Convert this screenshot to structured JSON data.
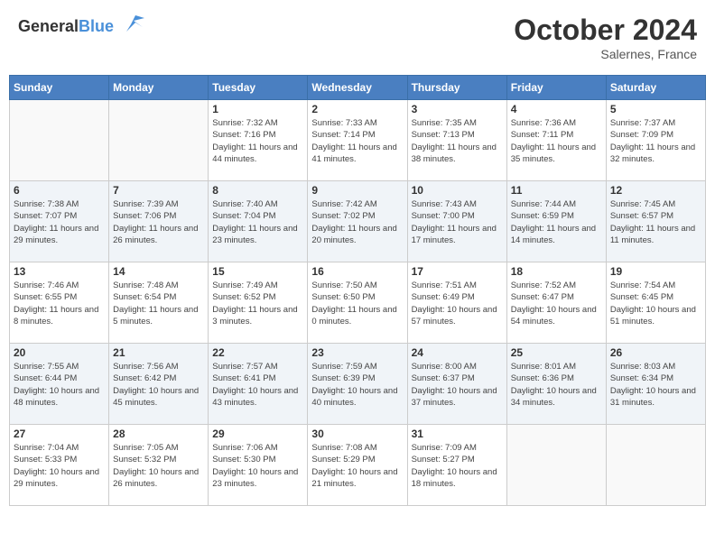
{
  "header": {
    "logo_general": "General",
    "logo_blue": "Blue",
    "month_title": "October 2024",
    "subtitle": "Salernes, France"
  },
  "days_of_week": [
    "Sunday",
    "Monday",
    "Tuesday",
    "Wednesday",
    "Thursday",
    "Friday",
    "Saturday"
  ],
  "weeks": [
    [
      {
        "day": "",
        "sunrise": "",
        "sunset": "",
        "daylight": ""
      },
      {
        "day": "",
        "sunrise": "",
        "sunset": "",
        "daylight": ""
      },
      {
        "day": "1",
        "sunrise": "Sunrise: 7:32 AM",
        "sunset": "Sunset: 7:16 PM",
        "daylight": "Daylight: 11 hours and 44 minutes."
      },
      {
        "day": "2",
        "sunrise": "Sunrise: 7:33 AM",
        "sunset": "Sunset: 7:14 PM",
        "daylight": "Daylight: 11 hours and 41 minutes."
      },
      {
        "day": "3",
        "sunrise": "Sunrise: 7:35 AM",
        "sunset": "Sunset: 7:13 PM",
        "daylight": "Daylight: 11 hours and 38 minutes."
      },
      {
        "day": "4",
        "sunrise": "Sunrise: 7:36 AM",
        "sunset": "Sunset: 7:11 PM",
        "daylight": "Daylight: 11 hours and 35 minutes."
      },
      {
        "day": "5",
        "sunrise": "Sunrise: 7:37 AM",
        "sunset": "Sunset: 7:09 PM",
        "daylight": "Daylight: 11 hours and 32 minutes."
      }
    ],
    [
      {
        "day": "6",
        "sunrise": "Sunrise: 7:38 AM",
        "sunset": "Sunset: 7:07 PM",
        "daylight": "Daylight: 11 hours and 29 minutes."
      },
      {
        "day": "7",
        "sunrise": "Sunrise: 7:39 AM",
        "sunset": "Sunset: 7:06 PM",
        "daylight": "Daylight: 11 hours and 26 minutes."
      },
      {
        "day": "8",
        "sunrise": "Sunrise: 7:40 AM",
        "sunset": "Sunset: 7:04 PM",
        "daylight": "Daylight: 11 hours and 23 minutes."
      },
      {
        "day": "9",
        "sunrise": "Sunrise: 7:42 AM",
        "sunset": "Sunset: 7:02 PM",
        "daylight": "Daylight: 11 hours and 20 minutes."
      },
      {
        "day": "10",
        "sunrise": "Sunrise: 7:43 AM",
        "sunset": "Sunset: 7:00 PM",
        "daylight": "Daylight: 11 hours and 17 minutes."
      },
      {
        "day": "11",
        "sunrise": "Sunrise: 7:44 AM",
        "sunset": "Sunset: 6:59 PM",
        "daylight": "Daylight: 11 hours and 14 minutes."
      },
      {
        "day": "12",
        "sunrise": "Sunrise: 7:45 AM",
        "sunset": "Sunset: 6:57 PM",
        "daylight": "Daylight: 11 hours and 11 minutes."
      }
    ],
    [
      {
        "day": "13",
        "sunrise": "Sunrise: 7:46 AM",
        "sunset": "Sunset: 6:55 PM",
        "daylight": "Daylight: 11 hours and 8 minutes."
      },
      {
        "day": "14",
        "sunrise": "Sunrise: 7:48 AM",
        "sunset": "Sunset: 6:54 PM",
        "daylight": "Daylight: 11 hours and 5 minutes."
      },
      {
        "day": "15",
        "sunrise": "Sunrise: 7:49 AM",
        "sunset": "Sunset: 6:52 PM",
        "daylight": "Daylight: 11 hours and 3 minutes."
      },
      {
        "day": "16",
        "sunrise": "Sunrise: 7:50 AM",
        "sunset": "Sunset: 6:50 PM",
        "daylight": "Daylight: 11 hours and 0 minutes."
      },
      {
        "day": "17",
        "sunrise": "Sunrise: 7:51 AM",
        "sunset": "Sunset: 6:49 PM",
        "daylight": "Daylight: 10 hours and 57 minutes."
      },
      {
        "day": "18",
        "sunrise": "Sunrise: 7:52 AM",
        "sunset": "Sunset: 6:47 PM",
        "daylight": "Daylight: 10 hours and 54 minutes."
      },
      {
        "day": "19",
        "sunrise": "Sunrise: 7:54 AM",
        "sunset": "Sunset: 6:45 PM",
        "daylight": "Daylight: 10 hours and 51 minutes."
      }
    ],
    [
      {
        "day": "20",
        "sunrise": "Sunrise: 7:55 AM",
        "sunset": "Sunset: 6:44 PM",
        "daylight": "Daylight: 10 hours and 48 minutes."
      },
      {
        "day": "21",
        "sunrise": "Sunrise: 7:56 AM",
        "sunset": "Sunset: 6:42 PM",
        "daylight": "Daylight: 10 hours and 45 minutes."
      },
      {
        "day": "22",
        "sunrise": "Sunrise: 7:57 AM",
        "sunset": "Sunset: 6:41 PM",
        "daylight": "Daylight: 10 hours and 43 minutes."
      },
      {
        "day": "23",
        "sunrise": "Sunrise: 7:59 AM",
        "sunset": "Sunset: 6:39 PM",
        "daylight": "Daylight: 10 hours and 40 minutes."
      },
      {
        "day": "24",
        "sunrise": "Sunrise: 8:00 AM",
        "sunset": "Sunset: 6:37 PM",
        "daylight": "Daylight: 10 hours and 37 minutes."
      },
      {
        "day": "25",
        "sunrise": "Sunrise: 8:01 AM",
        "sunset": "Sunset: 6:36 PM",
        "daylight": "Daylight: 10 hours and 34 minutes."
      },
      {
        "day": "26",
        "sunrise": "Sunrise: 8:03 AM",
        "sunset": "Sunset: 6:34 PM",
        "daylight": "Daylight: 10 hours and 31 minutes."
      }
    ],
    [
      {
        "day": "27",
        "sunrise": "Sunrise: 7:04 AM",
        "sunset": "Sunset: 5:33 PM",
        "daylight": "Daylight: 10 hours and 29 minutes."
      },
      {
        "day": "28",
        "sunrise": "Sunrise: 7:05 AM",
        "sunset": "Sunset: 5:32 PM",
        "daylight": "Daylight: 10 hours and 26 minutes."
      },
      {
        "day": "29",
        "sunrise": "Sunrise: 7:06 AM",
        "sunset": "Sunset: 5:30 PM",
        "daylight": "Daylight: 10 hours and 23 minutes."
      },
      {
        "day": "30",
        "sunrise": "Sunrise: 7:08 AM",
        "sunset": "Sunset: 5:29 PM",
        "daylight": "Daylight: 10 hours and 21 minutes."
      },
      {
        "day": "31",
        "sunrise": "Sunrise: 7:09 AM",
        "sunset": "Sunset: 5:27 PM",
        "daylight": "Daylight: 10 hours and 18 minutes."
      },
      {
        "day": "",
        "sunrise": "",
        "sunset": "",
        "daylight": ""
      },
      {
        "day": "",
        "sunrise": "",
        "sunset": "",
        "daylight": ""
      }
    ]
  ]
}
